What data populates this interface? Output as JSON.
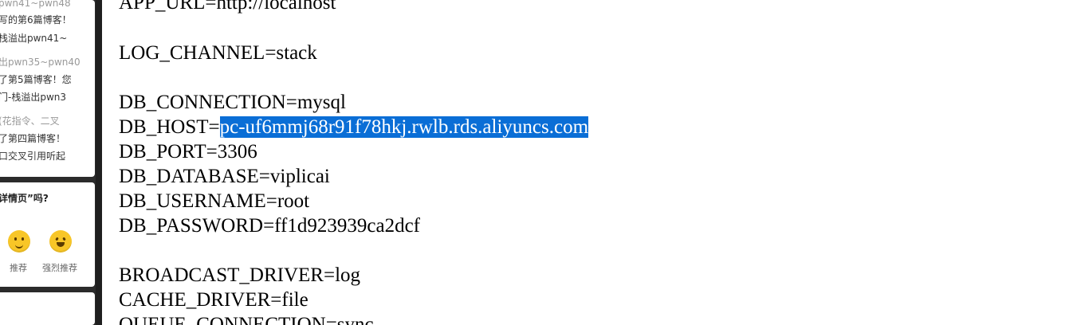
{
  "sidebar": {
    "recent_posts": [
      {
        "text": "pwn41~pwn48",
        "style": "gray"
      },
      {
        "text": "写的第6篇博客！",
        "style": "normal"
      },
      {
        "text": "栈溢出pwn41~",
        "style": "normal"
      },
      {
        "text": "出pwn35~pwn40",
        "style": "gray"
      },
      {
        "text": "了第5篇博客！您",
        "style": "normal"
      },
      {
        "text": "门-栈溢出pwn3",
        "style": "normal"
      },
      {
        "text": "(花指令、二叉",
        "style": "gray"
      },
      {
        "text": "了第四篇博客！",
        "style": "normal"
      },
      {
        "text": "口交叉引用听起",
        "style": "normal"
      }
    ],
    "feedback": {
      "question": "详情页”吗?",
      "options": [
        {
          "label": "推荐",
          "icon": "smile-emoji-icon"
        },
        {
          "label": "强烈推荐",
          "icon": "laugh-emoji-icon"
        }
      ]
    }
  },
  "editor": {
    "lines": [
      {
        "text": "APP_URL=http://localhost"
      },
      {
        "text": "LOG_CHANNEL=stack"
      },
      {
        "text": "DB_CONNECTION=mysql"
      },
      {
        "text": "DB_HOST=",
        "selected": "pc-uf6mmj68r91f78hkj.rwlb.rds.aliyuncs.com"
      },
      {
        "text": "DB_PORT=3306"
      },
      {
        "text": "DB_DATABASE=viplicai"
      },
      {
        "text": "DB_USERNAME=root"
      },
      {
        "text": "DB_PASSWORD=ff1d923939ca2dcf"
      },
      {
        "text": "BROADCAST_DRIVER=log"
      },
      {
        "text": "CACHE_DRIVER=file"
      },
      {
        "text": "QUEUE_CONNECTION=sync"
      }
    ]
  },
  "colors": {
    "selection": "#0a6ed6",
    "emoji": "#f8c627"
  }
}
